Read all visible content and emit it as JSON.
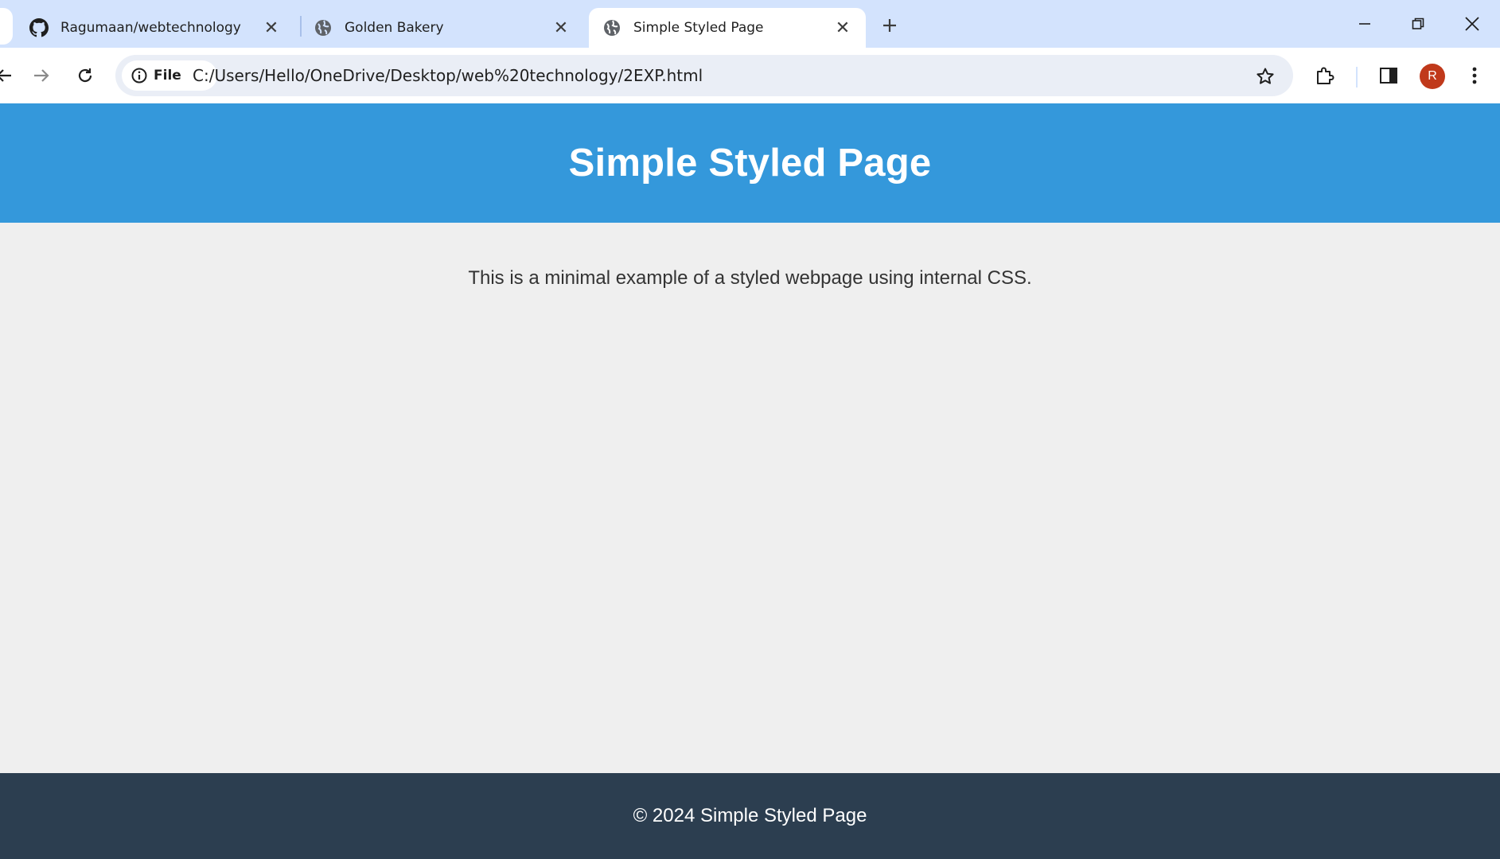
{
  "browser": {
    "tabs": [
      {
        "title": "Ragumaan/webtechnology",
        "icon": "github-icon",
        "active": false
      },
      {
        "title": "Golden Bakery",
        "icon": "globe-icon",
        "active": false
      },
      {
        "title": "Simple Styled Page",
        "icon": "globe-icon",
        "active": true
      }
    ],
    "address": {
      "chip_label": "File",
      "url": "C:/Users/Hello/OneDrive/Desktop/web%20technology/2EXP.html"
    },
    "profile_initial": "R",
    "colors": {
      "tabstrip": "#d3e3fd",
      "avatar": "#c0391b"
    }
  },
  "page": {
    "header_title": "Simple Styled Page",
    "body_text": "This is a minimal example of a styled webpage using internal CSS.",
    "footer_text": "© 2024 Simple Styled Page",
    "colors": {
      "header_bg": "#3498db",
      "body_bg": "#efefef",
      "footer_bg": "#2c3e50"
    }
  }
}
